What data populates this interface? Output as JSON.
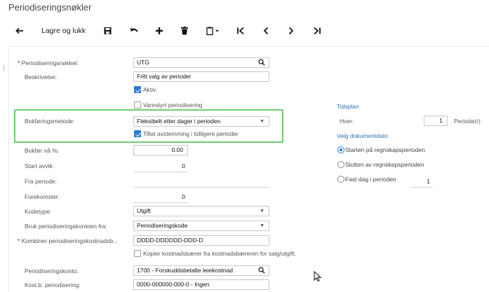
{
  "page": {
    "title": "Periodiseringsnøkler"
  },
  "toolbar": {
    "back_icon": "arrow-left-icon",
    "save_close_label": "Lagre og lukk",
    "save_icon": "floppy-disk-icon",
    "undo_icon": "undo-icon",
    "add_icon": "plus-icon",
    "delete_icon": "trash-icon",
    "copy_paste_icon": "clipboard-icon",
    "first_icon": "first-record-icon",
    "prev_icon": "chevron-left-icon",
    "next_icon": "chevron-right-icon",
    "last_icon": "last-record-icon"
  },
  "form": {
    "key": {
      "label": "Periodiseringsnøkkel:",
      "required": "*",
      "value": "UTG"
    },
    "description": {
      "label": "Beskrivelse:",
      "value": "Fritt valg av perioder"
    },
    "active": {
      "label": "Aktiv",
      "checked": true
    },
    "item_based": {
      "label": "Varestyrt periodisering",
      "checked": false
    },
    "posting_method": {
      "label": "Bokføringsmetode:",
      "value": "Fleksibelt etter dager i perioden"
    },
    "allow_reconcile": {
      "label": "Tillat avstemming i tidligere perioder",
      "checked": true
    },
    "post_now_pct": {
      "label": "Bokfør nå %:",
      "value": "0.00"
    },
    "start_offset": {
      "label": "Start avvik:",
      "value": "0"
    },
    "from_period": {
      "label": "Fra periode:",
      "value": ""
    },
    "occurrences": {
      "label": "Forekomster:",
      "value": "0"
    },
    "code_type": {
      "label": "Kodetype:",
      "value": "Utgift"
    },
    "use_account_from": {
      "label": "Bruk periodiseringskontoen fra:",
      "value": "Periodiseringskode"
    },
    "combine_sub": {
      "label": "Kombiner periodiseringskostnadsb...",
      "required": "*",
      "value": "DDDD-DDDDDD-DDD-D"
    },
    "copy_cost_center": {
      "label": "Kopier kostnadsbærer fra kostnadsbæreren for salg/utgift.",
      "checked": false
    },
    "deferral_account": {
      "label": "Periodiseringskonto:",
      "value": "1700 - Forskuddsbetalte leiekostnad"
    },
    "deferral_sub": {
      "label": "Kost.b. periodisering:",
      "value": "0000-000000-000-0 - Ingen"
    }
  },
  "schedule": {
    "title": "Tidsplan",
    "every_label": "Hver:",
    "every_value": "1",
    "unit": "Periode(r)",
    "doc_date_title": "Velg dokumentdato",
    "options": [
      {
        "label": "Starten på regnskapsperioden",
        "selected": true
      },
      {
        "label": "Slutten av regnskapsperioden",
        "selected": false
      },
      {
        "label": "Fast dag i perioden",
        "selected": false
      }
    ],
    "fixed_day_value": "1"
  }
}
